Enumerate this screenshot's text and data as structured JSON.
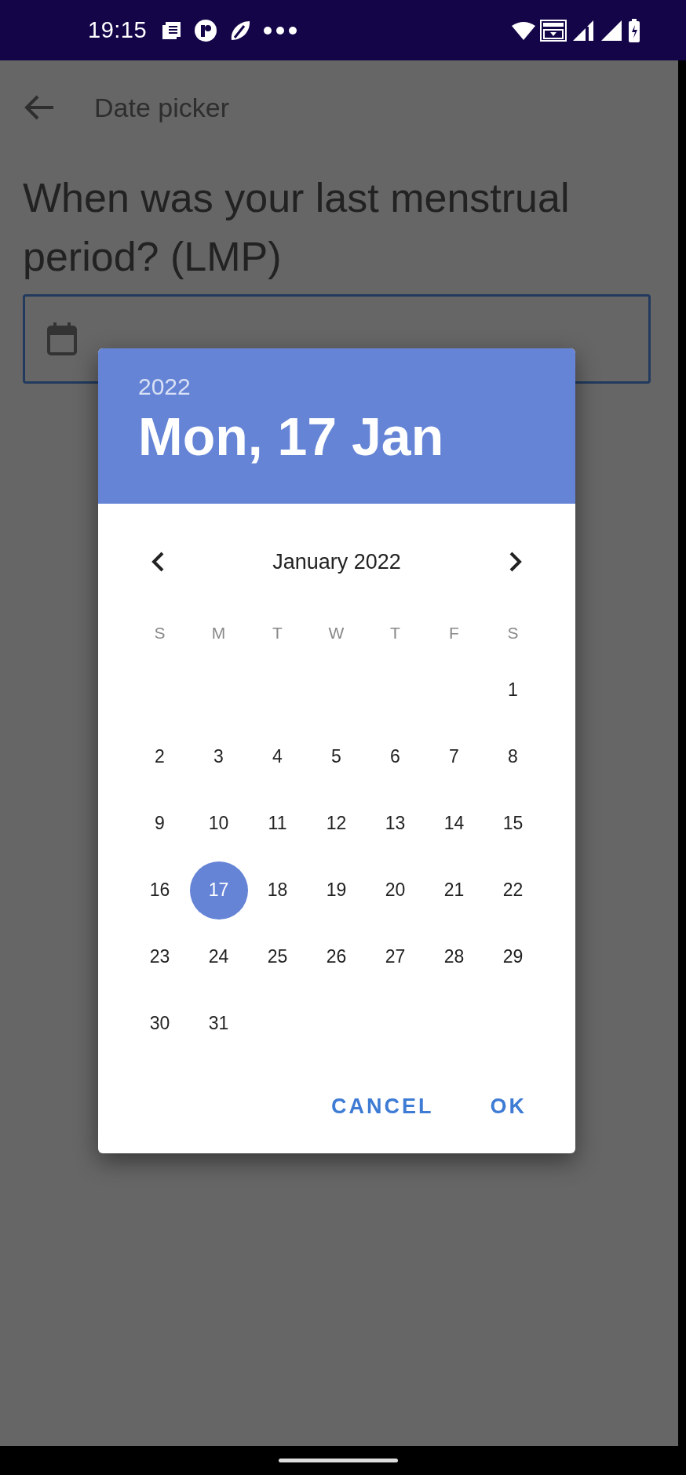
{
  "status_bar": {
    "time": "19:15"
  },
  "app_bar": {
    "title": "Date picker"
  },
  "question": {
    "label": "When was your last menstrual period? (LMP)"
  },
  "date_picker": {
    "year": "2022",
    "date": "Mon, 17 Jan",
    "month": "January 2022",
    "weekdays": [
      "S",
      "M",
      "T",
      "W",
      "T",
      "F",
      "S"
    ],
    "weeks": [
      [
        {
          "label": "1",
          "selected": false
        }
      ],
      [
        {
          "label": "2",
          "selected": false
        },
        {
          "label": "3",
          "selected": false
        },
        {
          "label": "4",
          "selected": false
        },
        {
          "label": "5",
          "selected": false
        },
        {
          "label": "6",
          "selected": false
        },
        {
          "label": "7",
          "selected": false
        },
        {
          "label": "8",
          "selected": false
        }
      ],
      [
        {
          "label": "9",
          "selected": false
        },
        {
          "label": "10",
          "selected": false
        },
        {
          "label": "11",
          "selected": false
        },
        {
          "label": "12",
          "selected": false
        },
        {
          "label": "13",
          "selected": false
        },
        {
          "label": "14",
          "selected": false
        },
        {
          "label": "15",
          "selected": false
        }
      ],
      [
        {
          "label": "16",
          "selected": false
        },
        {
          "label": "17",
          "selected": true
        },
        {
          "label": "18",
          "selected": false
        },
        {
          "label": "19",
          "selected": false
        },
        {
          "label": "20",
          "selected": false
        },
        {
          "label": "21",
          "selected": false
        },
        {
          "label": "22",
          "selected": false
        }
      ],
      [
        {
          "label": "23",
          "selected": false
        },
        {
          "label": "24",
          "selected": false
        },
        {
          "label": "25",
          "selected": false
        },
        {
          "label": "26",
          "selected": false
        },
        {
          "label": "27",
          "selected": false
        },
        {
          "label": "28",
          "selected": false
        },
        {
          "label": "29",
          "selected": false
        }
      ],
      [
        {
          "label": "30",
          "selected": false
        },
        {
          "label": "31",
          "selected": false
        }
      ]
    ],
    "buttons": [
      {
        "label": "CANCEL"
      },
      {
        "label": "OK"
      }
    ]
  }
}
